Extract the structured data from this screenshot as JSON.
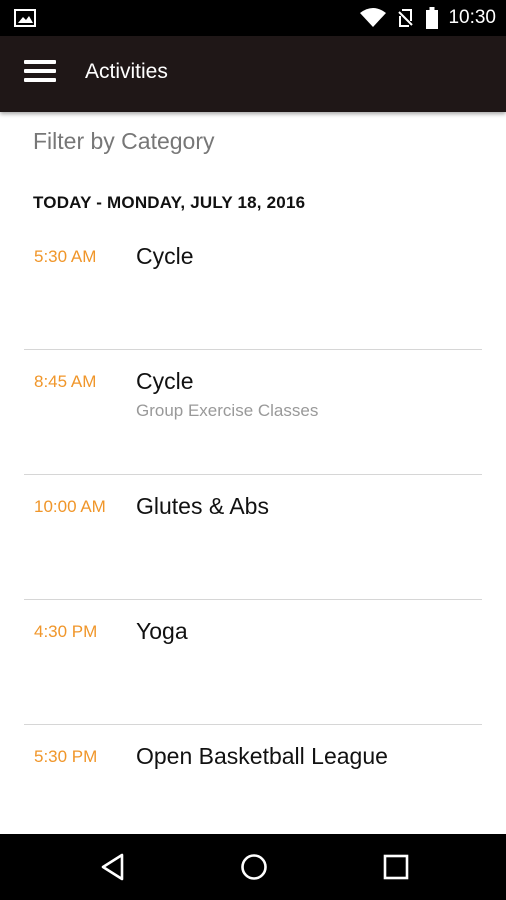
{
  "status_bar": {
    "time": "10:30",
    "icons": [
      "image-notification-icon",
      "wifi-icon",
      "no-signal-icon",
      "battery-icon"
    ]
  },
  "app_bar": {
    "title": "Activities",
    "menu_icon": "hamburger-menu-icon"
  },
  "filter": {
    "label": "Filter by Category"
  },
  "schedule": {
    "day_heading": "TODAY - MONDAY, JULY 18, 2016",
    "items": [
      {
        "time": "5:30 AM",
        "title": "Cycle",
        "subtitle": ""
      },
      {
        "time": "8:45 AM",
        "title": "Cycle",
        "subtitle": "Group Exercise Classes"
      },
      {
        "time": "10:00 AM",
        "title": "Glutes & Abs",
        "subtitle": ""
      },
      {
        "time": "4:30 PM",
        "title": "Yoga",
        "subtitle": ""
      },
      {
        "time": "5:30 PM",
        "title": "Open Basketball League",
        "subtitle": ""
      }
    ]
  },
  "nav_bar": {
    "buttons": [
      "back-icon",
      "home-icon",
      "recents-icon"
    ]
  },
  "colors": {
    "accent_time": "#f0962a",
    "app_bar": "#1f1717",
    "status_bar": "#000000"
  }
}
